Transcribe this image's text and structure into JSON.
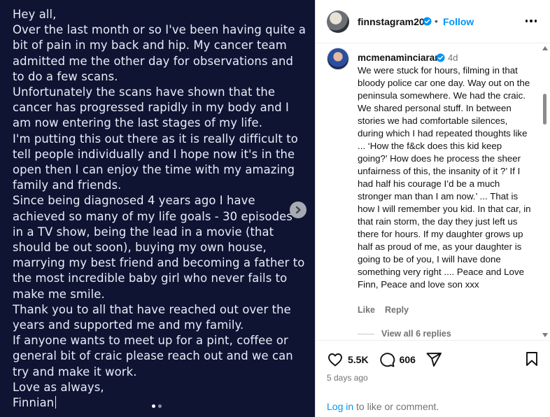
{
  "image_post": {
    "paragraphs": [
      "Hey all,",
      "Over the last month or so I've been having quite a bit of pain in my back and hip. My cancer team admitted me the other day for observations and to do a few scans.",
      "Unfortunately the scans have shown that the cancer has progressed rapidly in my body and I am now entering the last stages of my life.",
      "I'm putting this out there as it is really difficult to tell people individually and I hope now it's in the open then I can enjoy the time with my amazing family and friends.",
      "Since being diagnosed 4 years ago I have achieved so many of my life goals - 30 episodes in a TV show, being the lead in a movie (that should be out soon), buying my own house, marrying my best friend and becoming a father to the most incredible baby girl who never fails to make me smile.",
      "Thank you to all that have reached out over the years and supported me and my family.",
      "If anyone wants to meet up for a pint, coffee or general bit of craic please reach out and we can try and make it work.",
      "Love as always,",
      "Finnian"
    ],
    "carousel": {
      "current": 1,
      "total": 2
    }
  },
  "header": {
    "username": "finnstagram20",
    "separator": "•",
    "follow_label": "Follow",
    "verified_icon": "verified-badge-icon",
    "more_icon": "more-options-icon"
  },
  "comment": {
    "username": "mcmenaminciaran",
    "time": "4d",
    "text": "We were stuck for hours, filming in that bloody police car one day. Way out on the peninsula somewhere. We had the craic. We shared personal stuff. In between stories we had comfortable silences, during which I had repeated thoughts like ... ‘How the f&ck does this kid keep going?’ How does he process the sheer unfairness of this, the insanity of it ?’ If I had half his courage I’d be a much stronger man than I am now.’ ... That is how I will remember you kid. In that car, in that rain storm, the day they just left us there for hours. If my daughter grows up half as proud of me, as your daughter is going to be of you, I will have done something very right .... Peace and Love Finn, Peace and love son xxx",
    "like_label": "Like",
    "reply_label": "Reply",
    "view_replies_label": "View all 6 replies"
  },
  "footer": {
    "likes": "5.5K",
    "comments": "606",
    "posted": "5 days ago",
    "login_link": "Log in",
    "login_suffix": " to like or comment."
  },
  "colors": {
    "image_background": "#0f1433",
    "link_blue": "#0095f6",
    "verified_blue": "#0095f6"
  }
}
